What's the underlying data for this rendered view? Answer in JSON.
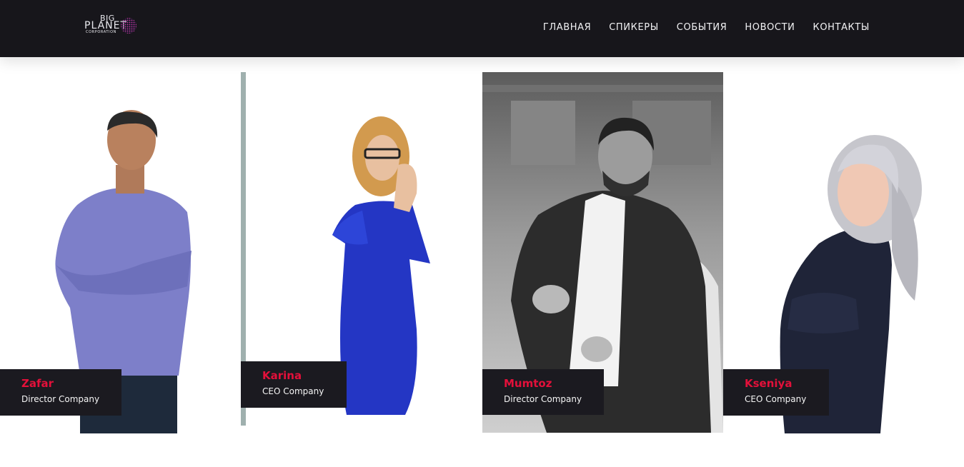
{
  "brand": {
    "logo_line1": "BIG",
    "logo_line2": "PLANET",
    "logo_line3": "CORPORATION",
    "logo_accent": "#b02a8a"
  },
  "nav": {
    "items": [
      {
        "label": "ГЛАВНАЯ"
      },
      {
        "label": "СПИКЕРЫ"
      },
      {
        "label": "СОБЫТИЯ"
      },
      {
        "label": "НОВОСТИ"
      },
      {
        "label": "КОНТАКТЫ"
      }
    ]
  },
  "speakers": [
    {
      "name": "Zafar",
      "role": "Director Company",
      "photo_style": "color",
      "shirt_color": "#7d7fc9"
    },
    {
      "name": "Karina",
      "role": "CEO Company",
      "photo_style": "color",
      "dress_color": "#2436c4"
    },
    {
      "name": "Mumtoz",
      "role": "Director Company",
      "photo_style": "black-and-white",
      "jacket_color": "#2c2c2c"
    },
    {
      "name": "Kseniya",
      "role": "CEO Company",
      "photo_style": "color",
      "jacket_color": "#1f2438"
    }
  ],
  "colors": {
    "header_bg": "#17161b",
    "label_bg": "#1b1a20",
    "name_accent": "#e3103a"
  }
}
